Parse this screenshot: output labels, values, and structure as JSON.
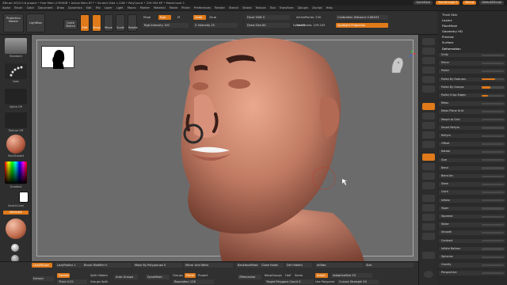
{
  "titlebar": {
    "text": "ZBrush 2022.0.6    project  •  Free Mem 2.993GB  •  Active Mem 877  •  Scratch Disk 1.2GB  •  PolyCount  •  229.594 KP  •  MeshCount 1",
    "quicksave": "QuickSave",
    "see_through": "See-through 0",
    "menus": "Menus",
    "defaultzscript": "DefaultZScript"
  },
  "menubar": [
    "Alpha",
    "Brush",
    "Color",
    "Document",
    "Draw",
    "Dynamics",
    "Edit",
    "File",
    "Layer",
    "Light",
    "Macro",
    "Marker",
    "Material",
    "Movie",
    "Picker",
    "Preferences",
    "Render",
    "Stencil",
    "Stroke",
    "Texture",
    "Tool",
    "Transform",
    "Zplugin",
    "Zscript",
    "Help"
  ],
  "topshelf": {
    "projection_master": "Projection Master",
    "lightbox": "LightBox",
    "quick_sketch": "Quick Sketch",
    "edit": "Edit",
    "draw": "Draw",
    "move": "Move",
    "scale": "Scale",
    "rotate": "Rotate",
    "mrgb": "Mrgb",
    "rgb": "Rgb",
    "m": "M",
    "zadd": "Zadd",
    "zsub": "Zsub",
    "rgb_intensity": "Rgb Intensity 100",
    "z_intensity": "Z Intensity 25",
    "focal_shift": "Focal Shift 0",
    "draw_size": "Draw Size 64",
    "dynamic": "Dynamic",
    "active_points": "ActivePoints: 230",
    "total_points": "TotalPoints: 229.203",
    "calibration": "Calibration Distance 0.66453",
    "spotlight": "Spotlight Projection"
  },
  "lefttray": {
    "brush": "Standard",
    "stroke": "Dots",
    "alpha": "Alpha Off",
    "texture": "Texture Off",
    "material": "SkinShade4",
    "gradient": "Gradient",
    "switch_color": "SwitchColor",
    "alternate": "Alternate"
  },
  "bottomshelf": {
    "lazymouse": "LazyMouse",
    "lazyradius": "LazyRadius 1",
    "brush_modifier": "Brush Modifier 0",
    "mask_by_polygroups": "Mask By Polygroups 0",
    "mirror_and_weld": "Mirror And Weld",
    "backface_mask": "BackfaceMask",
    "close_holes": "Close Holes",
    "del_hidden": "Del Hidden",
    "inflate": "Inflate",
    "size": "Size",
    "extract": "Extract",
    "double": "Double",
    "thick": "Thick 0.02",
    "split_hidden": "Split Hidden",
    "groups_split": "Groups Split",
    "auto_groups": "Auto Groups",
    "dynamesh": "DynaMesh",
    "groups": "Groups",
    "polish": "Polish",
    "project": "Project",
    "resolution": "Resolution 128",
    "zremesher": "ZRemesher",
    "keep_groups": "KeepGroups",
    "half": "Half",
    "same": "Same",
    "target_polygons": "Target Polygons Count 5",
    "adapt": "Adapt",
    "adaptive_size": "AdaptiveSize 50",
    "use_polypaint": "Use Polypaint",
    "curves_strength": "Curves Strength 50"
  },
  "rightpanel": {
    "headers": [
      "Thick Skin",
      "Layers",
      "FiberMesh",
      "Geometry HD",
      "Preview",
      "Surface",
      "Deformation"
    ],
    "rows": [
      {
        "label": "Unify",
        "v": 0
      },
      {
        "label": "Mirror",
        "v": 0
      },
      {
        "label": "Polish",
        "v": 0
      },
      {
        "label": "Polish By Features",
        "v": 0.6
      },
      {
        "label": "Polish By Groups",
        "v": 0.4
      },
      {
        "label": "Polish Crisp Edges",
        "v": 0.3
      },
      {
        "label": "Relax",
        "v": 0
      },
      {
        "label": "Relax Plane Grid",
        "v": 0
      },
      {
        "label": "Morph to Grid",
        "v": 0
      },
      {
        "label": "Smart ReSym",
        "v": 0
      },
      {
        "label": "ReSym",
        "v": 0
      },
      {
        "label": "Offset",
        "v": 0
      },
      {
        "label": "Rotate",
        "v": 0
      },
      {
        "label": "Size",
        "v": 0
      },
      {
        "label": "Bend",
        "v": 0
      },
      {
        "label": "Bend Arc",
        "v": 0
      },
      {
        "label": "Skew",
        "v": 0
      },
      {
        "label": "Cloth",
        "v": 0
      },
      {
        "label": "Inflate",
        "v": 0
      },
      {
        "label": "Taper",
        "v": 0
      },
      {
        "label": "Squeeze",
        "v": 0
      },
      {
        "label": "Noise",
        "v": 0
      },
      {
        "label": "Smooth",
        "v": 0
      },
      {
        "label": "Contract",
        "v": 0
      },
      {
        "label": "Inflate Balloon",
        "v": 0
      },
      {
        "label": "Spherize",
        "v": 0
      },
      {
        "label": "Gravity",
        "v": 0
      },
      {
        "label": "Perspective",
        "v": 0
      }
    ]
  },
  "colors": {
    "accent": "#e07a1a",
    "panel": "#303030",
    "viewport": "#6b6b6b",
    "skin": "#c9826a"
  }
}
